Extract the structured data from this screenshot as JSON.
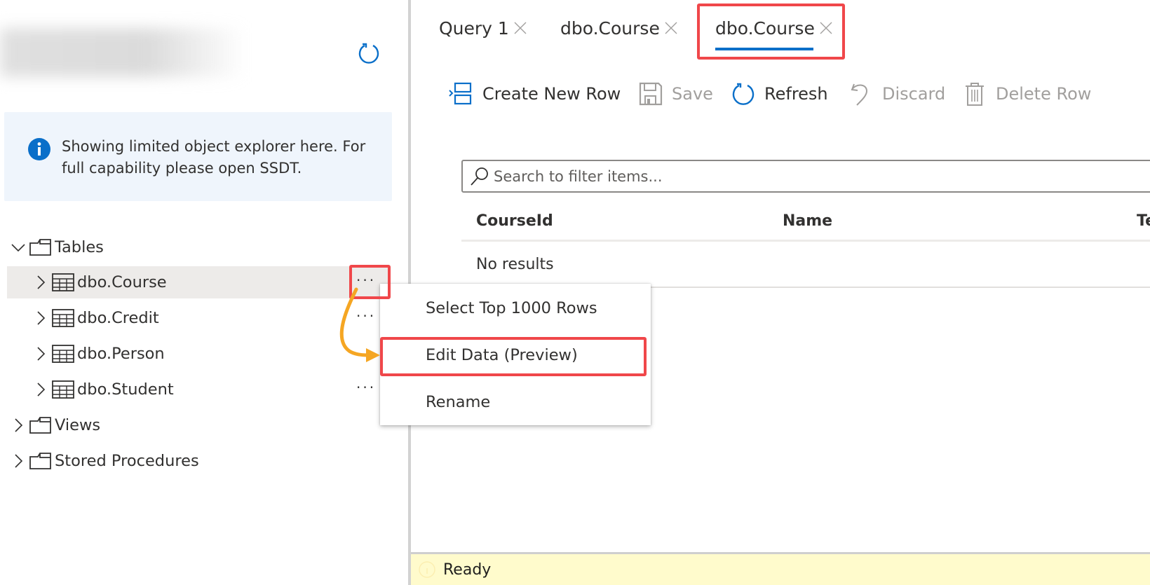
{
  "sidebar": {
    "title_blurred": true,
    "refresh_icon": "refresh-icon",
    "info_banner": {
      "icon": "info-icon",
      "text": "Showing limited object explorer here. For full capability please open SSDT."
    },
    "tree": [
      {
        "label": "Tables",
        "icon": "folder-icon",
        "expanded": true,
        "level": 0
      },
      {
        "label": "dbo.Course",
        "icon": "table-icon",
        "expanded": false,
        "level": 1,
        "selected": true
      },
      {
        "label": "dbo.Credit",
        "icon": "table-icon",
        "expanded": false,
        "level": 1
      },
      {
        "label": "dbo.Person",
        "icon": "table-icon",
        "expanded": false,
        "level": 1
      },
      {
        "label": "dbo.Student",
        "icon": "table-icon",
        "expanded": false,
        "level": 1
      },
      {
        "label": "Views",
        "icon": "folder-icon",
        "expanded": false,
        "level": 0
      },
      {
        "label": "Stored Procedures",
        "icon": "folder-icon",
        "expanded": false,
        "level": 0
      }
    ],
    "more_actions_label": "···"
  },
  "context_menu": {
    "items": [
      {
        "label": "Select Top 1000 Rows"
      },
      {
        "label": "Edit Data (Preview)",
        "highlighted": true
      },
      {
        "label": "Rename"
      }
    ]
  },
  "tabs": [
    {
      "label": "Query 1",
      "active": false
    },
    {
      "label": "dbo.Course",
      "active": false
    },
    {
      "label": "dbo.Course",
      "active": true
    }
  ],
  "toolbar": {
    "create_new_row": {
      "label": "Create New Row",
      "enabled": true
    },
    "save": {
      "label": "Save",
      "enabled": false
    },
    "refresh": {
      "label": "Refresh",
      "enabled": true
    },
    "discard": {
      "label": "Discard",
      "enabled": false
    },
    "delete_row": {
      "label": "Delete Row",
      "enabled": false
    }
  },
  "search": {
    "placeholder": "Search to filter items...",
    "value": ""
  },
  "grid": {
    "columns": [
      "CourseId",
      "Name",
      "Teacher"
    ],
    "rows": [],
    "empty_text": "No results"
  },
  "status_bar": {
    "text": "Ready"
  },
  "colors": {
    "accent": "#0a6fc9",
    "annotation_red": "#f0474a",
    "annotation_arrow": "#f5a623",
    "status_bg": "#fffbcc",
    "info_banner_bg": "#eff5fc",
    "selected_row_bg": "#edebe9"
  }
}
